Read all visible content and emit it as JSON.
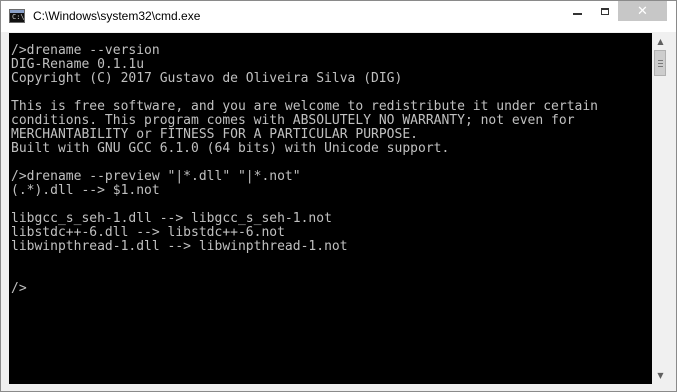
{
  "window": {
    "title": "C:\\Windows\\system32\\cmd.exe",
    "icon": "cmd-icon",
    "icon_glyph": "C:\\"
  },
  "controls": {
    "minimize": "minimize-icon",
    "maximize": "maximize-icon",
    "close": "close-icon",
    "close_glyph": "✕"
  },
  "console": {
    "lines": [
      "/>drename --version",
      "DIG-Rename 0.1.1u",
      "Copyright (C) 2017 Gustavo de Oliveira Silva (DIG)",
      "",
      "This is free software, and you are welcome to redistribute it under certain",
      "conditions. This program comes with ABSOLUTELY NO WARRANTY; not even for",
      "MERCHANTABILITY or FITNESS FOR A PARTICULAR PURPOSE.",
      "Built with GNU GCC 6.1.0 (64 bits) with Unicode support.",
      "",
      "/>drename --preview \"|*.dll\" \"|*.not\"",
      "(.*).dll --> $1.not",
      "",
      "libgcc_s_seh-1.dll --> libgcc_s_seh-1.not",
      "libstdc++-6.dll --> libstdc++-6.not",
      "libwinpthread-1.dll --> libwinpthread-1.not",
      "",
      "",
      "/>"
    ],
    "colors": {
      "background": "#000000",
      "foreground": "#c0c0c0"
    }
  },
  "scrollbar": {
    "up": "▲",
    "down": "▼"
  }
}
